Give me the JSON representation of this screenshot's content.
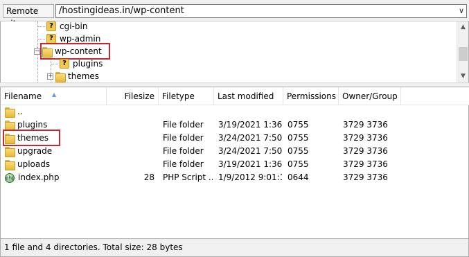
{
  "site_bar": {
    "label": "Remote site:",
    "path": "/hostingideas.in/wp-content",
    "dropdown_icon": "chevron-down-icon"
  },
  "tree": {
    "items": [
      {
        "label": "cgi-bin",
        "icon": "unknown-folder-icon"
      },
      {
        "label": "wp-admin",
        "icon": "unknown-folder-icon"
      },
      {
        "label": "wp-content",
        "icon": "folder-icon",
        "expanded": true,
        "selected": true
      },
      {
        "label": "plugins",
        "icon": "unknown-folder-icon"
      },
      {
        "label": "themes",
        "icon": "folder-icon"
      }
    ],
    "expander_open": "−",
    "expander_closed": "+"
  },
  "list": {
    "columns": [
      "Filename",
      "Filesize",
      "Filetype",
      "Last modified",
      "Permissions",
      "Owner/Group"
    ],
    "rows": [
      {
        "name": "..",
        "size": "",
        "type": "",
        "modified": "",
        "perms": "",
        "owner": "",
        "icon": "folder-icon"
      },
      {
        "name": "plugins",
        "size": "",
        "type": "File folder",
        "modified": "3/19/2021 1:36:...",
        "perms": "0755",
        "owner": "3729 3736",
        "icon": "folder-icon"
      },
      {
        "name": "themes",
        "size": "",
        "type": "File folder",
        "modified": "3/24/2021 7:50:...",
        "perms": "0755",
        "owner": "3729 3736",
        "icon": "folder-icon",
        "highlighted": true
      },
      {
        "name": "upgrade",
        "size": "",
        "type": "File folder",
        "modified": "3/24/2021 7:50:...",
        "perms": "0755",
        "owner": "3729 3736",
        "icon": "folder-icon"
      },
      {
        "name": "uploads",
        "size": "",
        "type": "File folder",
        "modified": "3/19/2021 1:36:...",
        "perms": "0755",
        "owner": "3729 3736",
        "icon": "folder-icon"
      },
      {
        "name": "index.php",
        "size": "28",
        "type": "PHP Script ...",
        "modified": "1/9/2012 9:01:1...",
        "perms": "0644",
        "owner": "3729 3736",
        "icon": "php-file-icon"
      }
    ]
  },
  "status": {
    "text": "1 file and 4 directories. Total size: 28 bytes"
  },
  "colors": {
    "highlight": "#c6282f",
    "folder": "#f0c850"
  }
}
